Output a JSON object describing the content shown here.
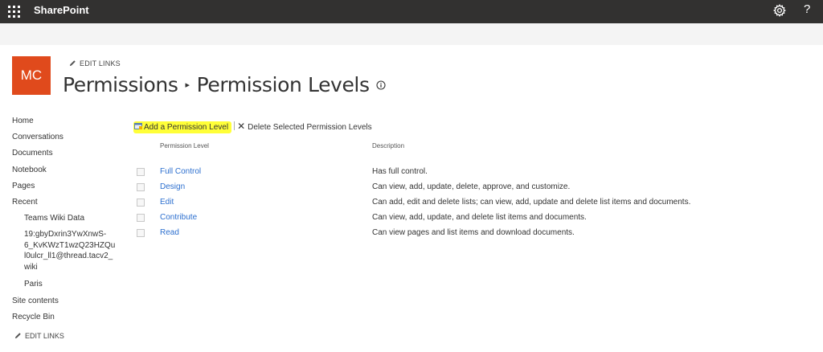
{
  "suite_bar": {
    "brand": "SharePoint",
    "help_label": "?"
  },
  "site": {
    "logo_text": "MC",
    "edit_links_label": "EDIT LINKS"
  },
  "page": {
    "breadcrumb_parent": "Permissions",
    "breadcrumb_separator": "▸",
    "title": "Permission Levels"
  },
  "left_nav": {
    "items": [
      "Home",
      "Conversations",
      "Documents",
      "Notebook",
      "Pages",
      "Recent"
    ],
    "recent": {
      "teams_wiki": "Teams Wiki Data",
      "thread_lines": [
        "19:gbyDxrin3YwXnwS-",
        "6_KvKWzT1wzQ23HZQu",
        "l0ulcr_ll1@thread.tacv2_",
        "wiki"
      ],
      "paris": "Paris"
    },
    "site_contents": "Site contents",
    "recycle_bin": "Recycle Bin",
    "edit_links_label": "EDIT LINKS"
  },
  "toolbar": {
    "add_label": "Add a Permission Level",
    "delete_label": "Delete Selected Permission Levels"
  },
  "table": {
    "columns": [
      "Permission Level",
      "Description"
    ],
    "rows": [
      {
        "name": "Full Control",
        "description": "Has full control."
      },
      {
        "name": "Design",
        "description": "Can view, add, update, delete, approve, and customize."
      },
      {
        "name": "Edit",
        "description": "Can add, edit and delete lists; can view, add, update and delete list items and documents."
      },
      {
        "name": "Contribute",
        "description": "Can view, add, update, and delete list items and documents."
      },
      {
        "name": "Read",
        "description": "Can view pages and list items and download documents."
      }
    ]
  },
  "colors": {
    "suite_bar": "#323130",
    "logo_background": "#e04a1c",
    "link": "#2c6fcf",
    "highlight": "#ffff38"
  },
  "icons": [
    "waffle-icon",
    "gear-icon",
    "help-icon",
    "pencil-icon",
    "info-icon",
    "add-permission-icon",
    "close-icon"
  ]
}
